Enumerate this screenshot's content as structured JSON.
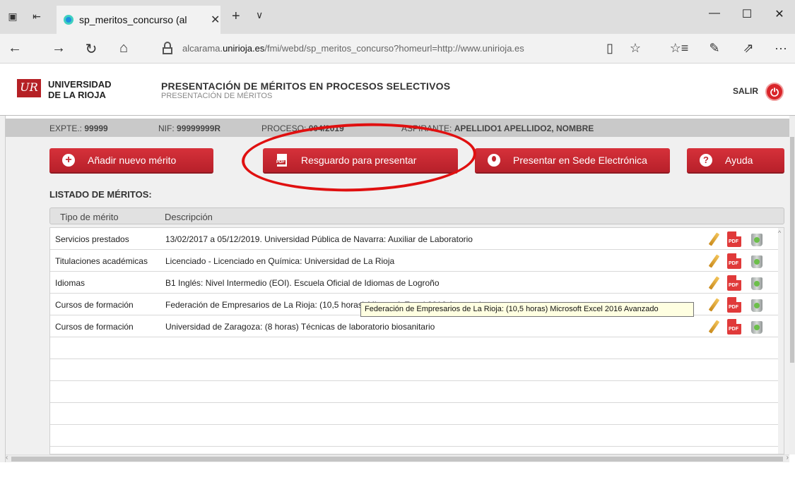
{
  "browser": {
    "tab_title": "sp_meritos_concurso (al",
    "tab_close": "✕",
    "new_tab": "+",
    "tab_list": "∨",
    "url_prefix": "alcarama.",
    "url_domain": "unirioja.es",
    "url_rest": "/fmi/webd/sp_meritos_concurso?homeurl=http://www.unirioja.es",
    "window_controls": [
      "—",
      "☐",
      "✕"
    ],
    "nav": {
      "back": "←",
      "forward": "→",
      "refresh": "↻",
      "home": "⌂"
    },
    "addr_icons": {
      "reading": "▯",
      "favorite": "☆",
      "favorites_list": "☆≡",
      "notes": "✎",
      "share": "⇗",
      "more": "···"
    }
  },
  "header": {
    "logo_mark": "UR",
    "logo_line1": "UNIVERSIDAD",
    "logo_line2": "DE LA RIOJA",
    "title": "PRESENTACIÓN DE MÉRITOS EN PROCESOS SELECTIVOS",
    "subtitle": "PRESENTACIÓN DE MÉRITOS",
    "logout_label": "SALIR",
    "accent_color": "#d9252a"
  },
  "infobar": {
    "expte_label": "EXPTE.:",
    "expte_value": "99999",
    "nif_label": "NIF:",
    "nif_value": "99999999R",
    "proceso_label": "PROCESO:",
    "proceso_value": "004/2019",
    "aspirante_label": "ASPIRANTE:",
    "aspirante_value": "APELLIDO1 APELLIDO2, NOMBRE"
  },
  "toolbar": {
    "add_label": "Añadir nuevo mérito",
    "receipt_label": "Resguardo para presentar",
    "submit_label": "Presentar en Sede Electrónica",
    "help_label": "Ayuda"
  },
  "list": {
    "title": "LISTADO DE MÉRITOS:",
    "columns": [
      "Tipo de mérito",
      "Descripción"
    ],
    "rows": [
      {
        "type": "Servicios prestados",
        "description": "13/02/2017 a 05/12/2019. Universidad Pública de Navarra: Auxiliar de Laboratorio"
      },
      {
        "type": "Titulaciones académicas",
        "description": "Licenciado - Licenciado en Química: Universidad de La Rioja"
      },
      {
        "type": "Idiomas",
        "description": "B1 Inglés: Nivel Intermedio (EOI). Escuela Oficial de Idiomas de Logroño"
      },
      {
        "type": "Cursos de formación",
        "description": "Federación de Empresarios de La Rioja: (10,5 horas) Microsoft Excel 2016 Avanzado"
      },
      {
        "type": "Cursos de formación",
        "description": "Universidad de Zaragoza: (8 horas) Técnicas de laboratorio biosanitario"
      }
    ],
    "tooltip": "Federación de Empresarios de La Rioja: (10,5 horas) Microsoft Excel 2016 Avanzado"
  },
  "icons": {
    "edit": "pencil-icon",
    "pdf": "PDF",
    "delete": "trash-icon"
  }
}
